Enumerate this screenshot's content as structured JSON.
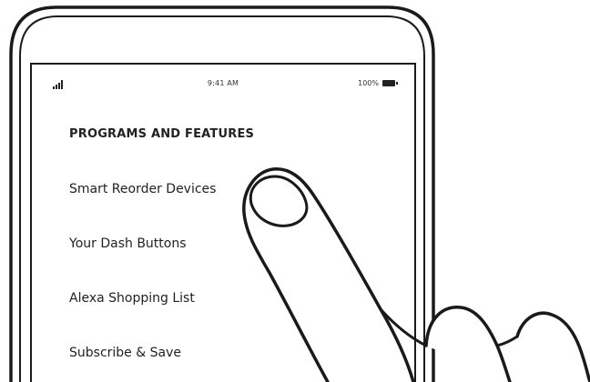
{
  "status_bar": {
    "time": "9:41 AM",
    "battery_percent": "100%",
    "signal_icon": "signal-bars-icon",
    "battery_icon": "battery-full-icon"
  },
  "screen": {
    "section_title": "PROGRAMS AND FEATURES",
    "items": [
      {
        "label": "Smart Reorder Devices"
      },
      {
        "label": "Your Dash Buttons"
      },
      {
        "label": "Alexa Shopping List"
      },
      {
        "label": "Subscribe & Save"
      }
    ]
  },
  "illustration": {
    "device": "smartphone-outline",
    "gesture": "pointing-hand-icon"
  }
}
